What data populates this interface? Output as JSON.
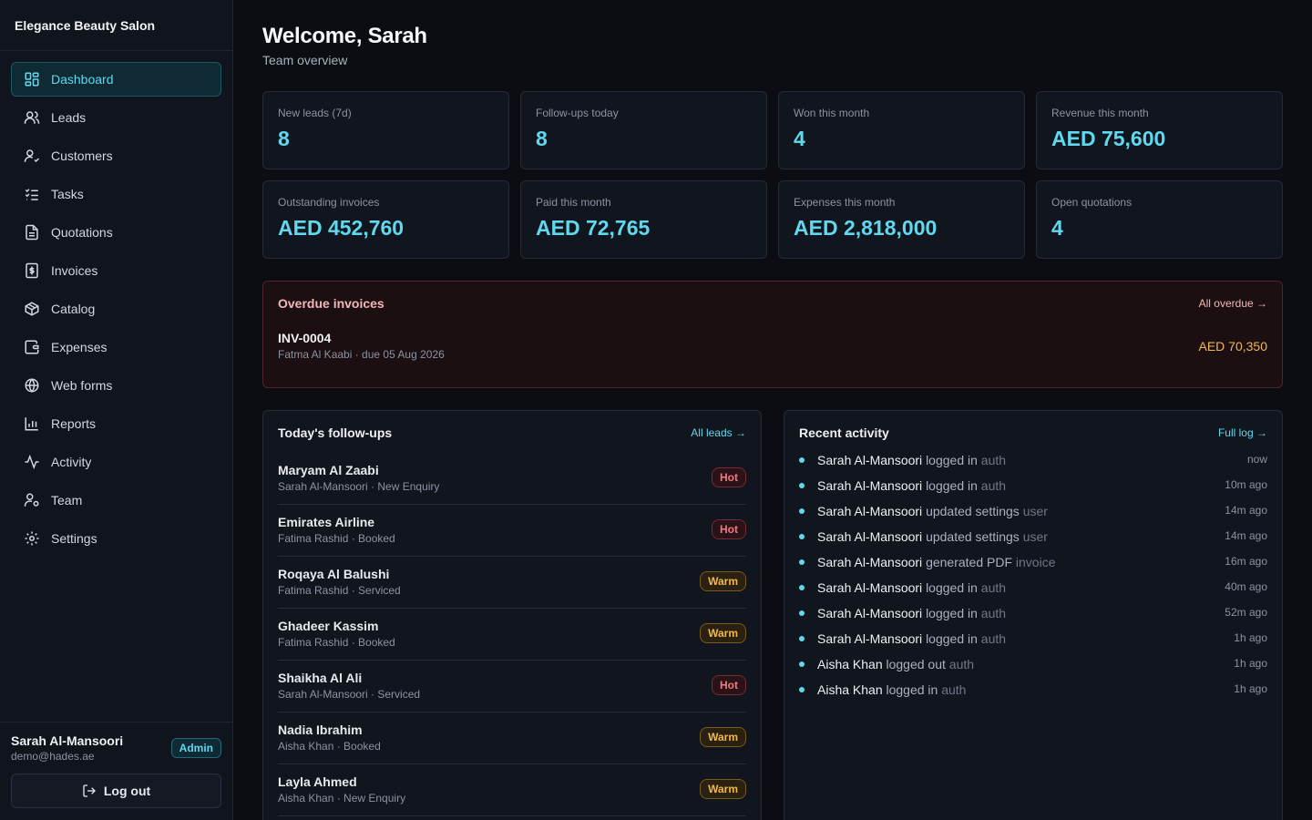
{
  "brand": "Elegance Beauty Salon",
  "nav": [
    {
      "label": "Dashboard",
      "icon": "dashboard-icon",
      "active": true
    },
    {
      "label": "Leads",
      "icon": "users-icon"
    },
    {
      "label": "Customers",
      "icon": "user-check-icon"
    },
    {
      "label": "Tasks",
      "icon": "list-checks-icon"
    },
    {
      "label": "Quotations",
      "icon": "file-text-icon"
    },
    {
      "label": "Invoices",
      "icon": "dollar-file-icon"
    },
    {
      "label": "Catalog",
      "icon": "box-icon"
    },
    {
      "label": "Expenses",
      "icon": "wallet-icon"
    },
    {
      "label": "Web forms",
      "icon": "globe-icon"
    },
    {
      "label": "Reports",
      "icon": "bar-chart-icon"
    },
    {
      "label": "Activity",
      "icon": "activity-icon"
    },
    {
      "label": "Team",
      "icon": "user-cog-icon"
    },
    {
      "label": "Settings",
      "icon": "gear-icon"
    }
  ],
  "user": {
    "name": "Sarah Al-Mansoori",
    "email": "demo@hades.ae",
    "role": "Admin",
    "logout_label": "Log out"
  },
  "header": {
    "title": "Welcome, Sarah",
    "subtitle": "Team overview"
  },
  "stats": [
    {
      "label": "New leads (7d)",
      "value": "8"
    },
    {
      "label": "Follow-ups today",
      "value": "8"
    },
    {
      "label": "Won this month",
      "value": "4"
    },
    {
      "label": "Revenue this month",
      "value": "AED 75,600"
    },
    {
      "label": "Outstanding invoices",
      "value": "AED 452,760"
    },
    {
      "label": "Paid this month",
      "value": "AED 72,765"
    },
    {
      "label": "Expenses this month",
      "value": "AED 2,818,000"
    },
    {
      "label": "Open quotations",
      "value": "4"
    }
  ],
  "overdue": {
    "title": "Overdue invoices",
    "link": "All overdue →",
    "invoices": [
      {
        "number": "INV-0004",
        "meta": "Fatma Al Kaabi · due 05 Aug 2026",
        "amount": "AED 70,350"
      }
    ]
  },
  "followups": {
    "title": "Today's follow-ups",
    "link": "All leads →",
    "items": [
      {
        "name": "Maryam Al Zaabi",
        "meta": "Sarah Al-Mansoori · New Enquiry",
        "badge": "Hot"
      },
      {
        "name": "Emirates Airline",
        "meta": "Fatima Rashid · Booked",
        "badge": "Hot"
      },
      {
        "name": "Roqaya Al Balushi",
        "meta": "Fatima Rashid · Serviced",
        "badge": "Warm"
      },
      {
        "name": "Ghadeer Kassim",
        "meta": "Fatima Rashid · Booked",
        "badge": "Warm"
      },
      {
        "name": "Shaikha Al Ali",
        "meta": "Sarah Al-Mansoori · Serviced",
        "badge": "Hot"
      },
      {
        "name": "Nadia Ibrahim",
        "meta": "Aisha Khan · Booked",
        "badge": "Warm"
      },
      {
        "name": "Layla Ahmed",
        "meta": "Aisha Khan · New Enquiry",
        "badge": "Warm"
      }
    ]
  },
  "activity": {
    "title": "Recent activity",
    "link": "Full log →",
    "items": [
      {
        "actor": "Sarah Al-Mansoori",
        "verb": "logged in",
        "target": "auth",
        "time": "now"
      },
      {
        "actor": "Sarah Al-Mansoori",
        "verb": "logged in",
        "target": "auth",
        "time": "10m ago"
      },
      {
        "actor": "Sarah Al-Mansoori",
        "verb": "updated settings",
        "target": "user",
        "time": "14m ago"
      },
      {
        "actor": "Sarah Al-Mansoori",
        "verb": "updated settings",
        "target": "user",
        "time": "14m ago"
      },
      {
        "actor": "Sarah Al-Mansoori",
        "verb": "generated PDF",
        "target": "invoice",
        "time": "16m ago"
      },
      {
        "actor": "Sarah Al-Mansoori",
        "verb": "logged in",
        "target": "auth",
        "time": "40m ago"
      },
      {
        "actor": "Sarah Al-Mansoori",
        "verb": "logged in",
        "target": "auth",
        "time": "52m ago"
      },
      {
        "actor": "Sarah Al-Mansoori",
        "verb": "logged in",
        "target": "auth",
        "time": "1h ago"
      },
      {
        "actor": "Aisha Khan",
        "verb": "logged out",
        "target": "auth",
        "time": "1h ago"
      },
      {
        "actor": "Aisha Khan",
        "verb": "logged in",
        "target": "auth",
        "time": "1h ago"
      }
    ]
  },
  "colors": {
    "accent": "#5fd8f0",
    "hot": "#f07a7f",
    "warm": "#f2b84b",
    "danger_bg": "#1b0f12"
  }
}
